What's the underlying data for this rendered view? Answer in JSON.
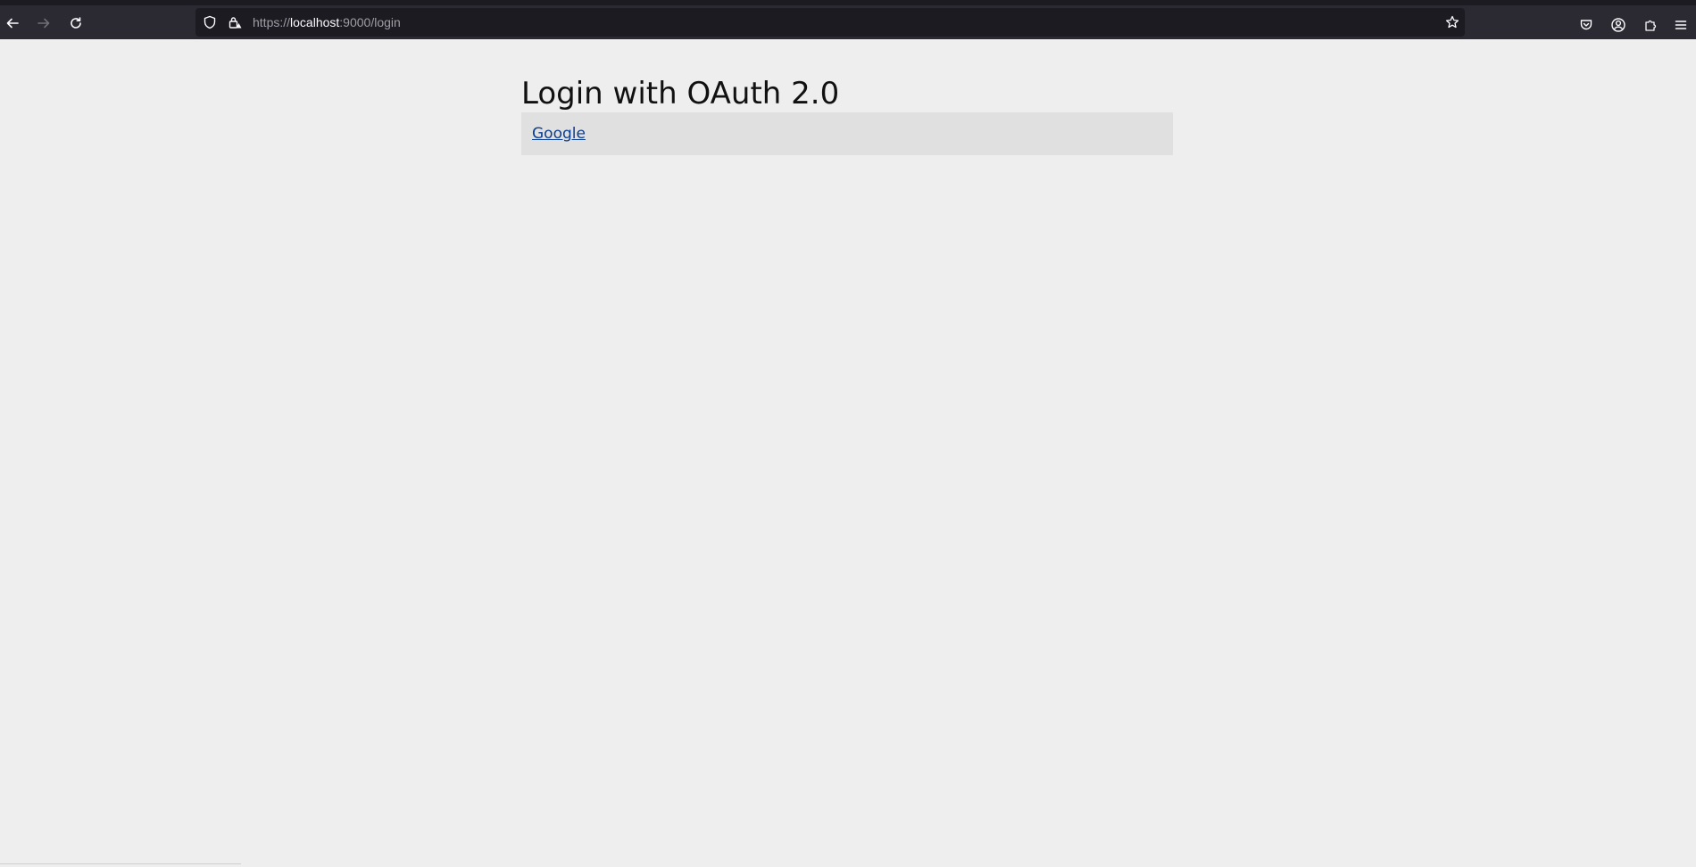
{
  "browser": {
    "url_scheme": "https://",
    "url_host": "localhost",
    "url_rest": ":9000/login",
    "icons": {
      "back": "arrow-left-icon",
      "forward": "arrow-right-icon",
      "reload": "reload-icon",
      "tracking": "shield-icon",
      "security": "lock-warning-icon",
      "bookmark": "star-icon",
      "pocket": "pocket-icon",
      "account": "account-icon",
      "extensions": "puzzle-icon",
      "menu": "hamburger-menu-icon"
    },
    "colors": {
      "toolbar": "#2b2a33",
      "urlbar": "#1c1b22",
      "icon": "#fbfbfe"
    }
  },
  "page": {
    "title": "Login with OAuth 2.0",
    "providers": [
      {
        "label": "Google"
      }
    ],
    "colors": {
      "background": "#eeeeee",
      "box": "#e0e0e0",
      "link": "#0b3d91"
    }
  }
}
